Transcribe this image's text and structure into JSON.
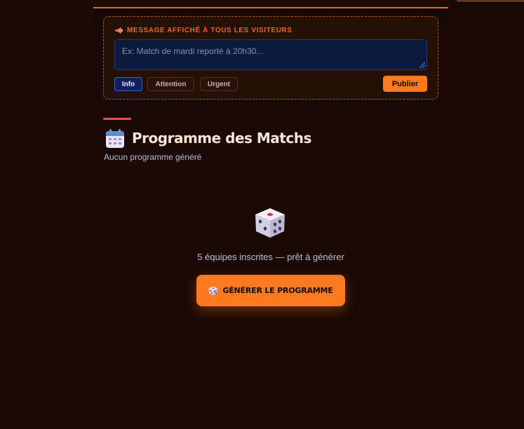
{
  "announcement": {
    "label": "MESSAGE AFFICHÉ À TOUS LES VISITEURS",
    "icon": "megaphone-icon",
    "placeholder": "Ex: Match de mardi reporté à 20h30...",
    "types": [
      "Info",
      "Attention",
      "Urgent"
    ],
    "selected_type": "Info",
    "publish_label": "Publier"
  },
  "section": {
    "icon": "calendar-icon",
    "title": "Programme des Matchs",
    "subtitle": "Aucun programme généré"
  },
  "empty_state": {
    "icon": "dice-icon",
    "message": "5 équipes inscrites — prêt à générer",
    "button_label": "GÉNÉRER LE PROGRAMME"
  },
  "colors": {
    "background": "#1a0905",
    "accent": "#ff7a1f",
    "panel_border": "#b4541f",
    "input_bg": "#0c1a3d"
  }
}
